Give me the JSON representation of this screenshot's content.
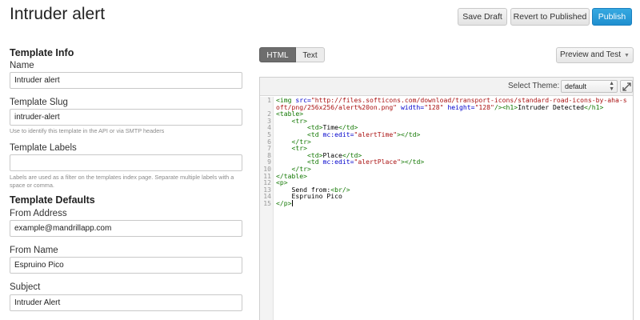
{
  "header": {
    "title": "Intruder alert",
    "save_draft": "Save Draft",
    "revert": "Revert to Published",
    "publish": "Publish"
  },
  "left": {
    "template_info": "Template Info",
    "name_label": "Name",
    "name_value": "Intruder alert",
    "slug_label": "Template Slug",
    "slug_value": "intruder-alert",
    "slug_help": "Use to identify this template in the API or via SMTP headers",
    "labels_label": "Template Labels",
    "labels_value": "",
    "labels_help": "Labels are used as a filter on the templates index page. Separate multiple labels with a space or comma.",
    "template_defaults": "Template Defaults",
    "from_address_label": "From Address",
    "from_address_value": "example@mandrillapp.com",
    "from_name_label": "From Name",
    "from_name_value": "Espruino Pico",
    "subject_label": "Subject",
    "subject_value": "Intruder Alert"
  },
  "editor": {
    "tabs": [
      "HTML",
      "Text"
    ],
    "active_tab": "HTML",
    "preview_button": "Preview and Test",
    "theme_label": "Select Theme:",
    "theme_value": "default",
    "lines": [
      [
        [
          "<",
          "tag"
        ],
        [
          "img ",
          "tag"
        ],
        [
          "src=",
          "attr"
        ],
        [
          "\"http://files.softicons.com/download/transport-icons/standard-road-icons-by-aha-soft/png/256x256/alert%20on.png\"",
          "str"
        ],
        [
          " ",
          "text"
        ],
        [
          "width=",
          "attr"
        ],
        [
          "\"128\"",
          "str"
        ],
        [
          " ",
          "text"
        ],
        [
          "height=",
          "attr"
        ],
        [
          "\"128\"",
          "str"
        ],
        [
          "/>",
          "tag"
        ],
        [
          "<h1>",
          "tag"
        ],
        [
          "Intruder Detected",
          "text"
        ],
        [
          "</h1>",
          "tag"
        ]
      ],
      [
        [
          "<table>",
          "tag"
        ]
      ],
      [
        [
          "    ",
          "text"
        ],
        [
          "<tr>",
          "tag"
        ]
      ],
      [
        [
          "        ",
          "text"
        ],
        [
          "<td>",
          "tag"
        ],
        [
          "Time",
          "text"
        ],
        [
          "</td>",
          "tag"
        ]
      ],
      [
        [
          "        ",
          "text"
        ],
        [
          "<td ",
          "tag"
        ],
        [
          "mc:edit=",
          "attr"
        ],
        [
          "\"alertTime\"",
          "str"
        ],
        [
          ">",
          "tag"
        ],
        [
          "</td>",
          "tag"
        ]
      ],
      [
        [
          "    ",
          "text"
        ],
        [
          "</tr>",
          "tag"
        ]
      ],
      [
        [
          "    ",
          "text"
        ],
        [
          "<tr>",
          "tag"
        ]
      ],
      [
        [
          "        ",
          "text"
        ],
        [
          "<td>",
          "tag"
        ],
        [
          "Place",
          "text"
        ],
        [
          "</td>",
          "tag"
        ]
      ],
      [
        [
          "        ",
          "text"
        ],
        [
          "<td ",
          "tag"
        ],
        [
          "mc:edit=",
          "attr"
        ],
        [
          "\"alertPlace\"",
          "str"
        ],
        [
          ">",
          "tag"
        ],
        [
          "</td>",
          "tag"
        ]
      ],
      [
        [
          "    ",
          "text"
        ],
        [
          "</tr>",
          "tag"
        ]
      ],
      [
        [
          "</table>",
          "tag"
        ]
      ],
      [
        [
          "<p>",
          "tag"
        ]
      ],
      [
        [
          "    Send from:",
          "text"
        ],
        [
          "<br/>",
          "tag"
        ]
      ],
      [
        [
          "    Espruino Pico",
          "text"
        ]
      ],
      [
        [
          "</p>",
          "tag"
        ]
      ]
    ]
  }
}
